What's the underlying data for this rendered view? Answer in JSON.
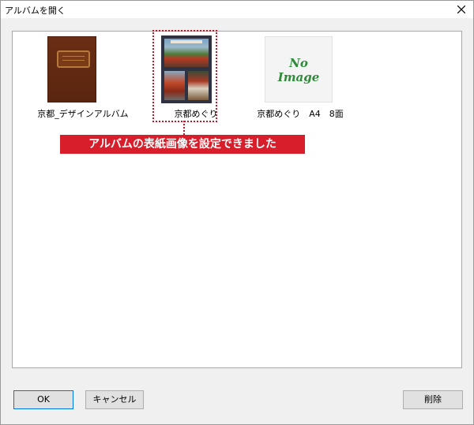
{
  "window": {
    "title": "アルバムを開く",
    "close_icon": "close-icon"
  },
  "albums": [
    {
      "label": "京都_デザインアルバム",
      "thumbnail": "brown-notebook-cover"
    },
    {
      "label": "京都めぐり",
      "thumbnail": "photo-collage-cover",
      "selected": true
    },
    {
      "label": "京都めぐり　A4　8面",
      "thumbnail": "no-image",
      "placeholder_line1": "No",
      "placeholder_line2": "Image"
    }
  ],
  "callout": {
    "text": "アルバムの表紙画像を設定できました",
    "color": "#d81e2a"
  },
  "buttons": {
    "ok": "OK",
    "cancel": "キャンセル",
    "delete": "削除"
  }
}
